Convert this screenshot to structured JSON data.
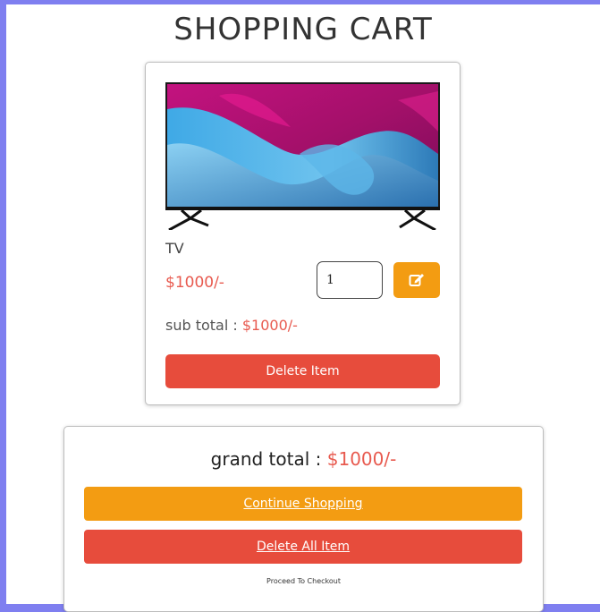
{
  "page": {
    "title": "SHOPPING CART"
  },
  "cart": {
    "items": [
      {
        "name": "TV",
        "image_icon": "television-image",
        "price": "$1000/-",
        "quantity": "1",
        "subtotal_label": "sub total : ",
        "subtotal_value": "$1000/-",
        "edit_icon": "edit-icon",
        "delete_label": "Delete Item"
      }
    ]
  },
  "summary": {
    "grand_total_label": "grand total : ",
    "grand_total_value": "$1000/-",
    "continue_label": "Continue Shopping",
    "delete_all_label": "Delete All Item",
    "checkout_label": "Proceed To Checkout"
  },
  "colors": {
    "accent_orange": "#f39c12",
    "danger_red": "#e74c3c",
    "price_red": "#e85a4f",
    "frame_blue": "#7f7ff0"
  }
}
